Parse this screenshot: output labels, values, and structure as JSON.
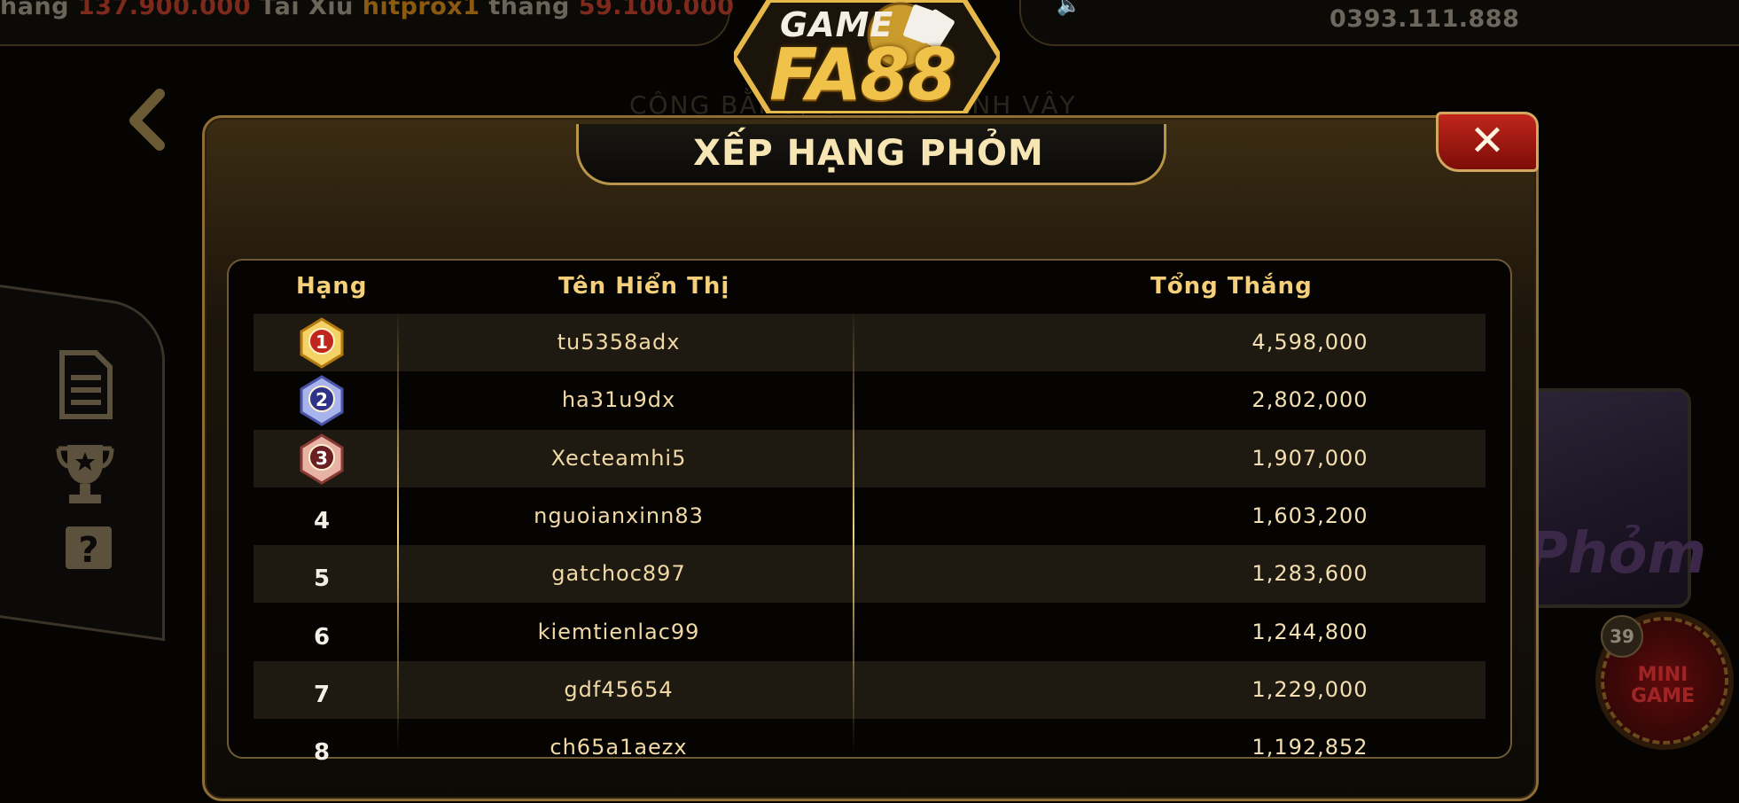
{
  "background": {
    "ticker_left_parts": [
      {
        "text": "hang ",
        "kind": "plain"
      },
      {
        "text": "137.900.000",
        "kind": "amount"
      },
      {
        "text": "   Tài Xỉu ",
        "kind": "plain"
      },
      {
        "text": "hitprox1",
        "kind": "nick"
      },
      {
        "text": " thắng ",
        "kind": "plain"
      },
      {
        "text": "59.100.000",
        "kind": "amount"
      }
    ],
    "hotline": "0393.111.888",
    "slogan": "CÔNG BẰNG, CHỨNG DANH VẬY",
    "tile_text": "Phỏm",
    "mini_game_label": "MINI GAME",
    "mini_game_badge": "39"
  },
  "logo": {
    "game": "GAME",
    "brand": "FA88"
  },
  "modal": {
    "title": "XẾP HẠNG PHỎM",
    "close_label": "✕",
    "columns": {
      "rank": "Hạng",
      "name": "Tên Hiển Thị",
      "total": "Tổng Thắng"
    },
    "rows": [
      {
        "rank": "1",
        "medal": "gold",
        "name": "tu5358adx",
        "total": "4,598,000"
      },
      {
        "rank": "2",
        "medal": "silver",
        "name": "ha31u9dx",
        "total": "2,802,000"
      },
      {
        "rank": "3",
        "medal": "bronze",
        "name": "Xecteamhi5",
        "total": "1,907,000"
      },
      {
        "rank": "4",
        "medal": "",
        "name": "nguoianxinn83",
        "total": "1,603,200"
      },
      {
        "rank": "5",
        "medal": "",
        "name": "gatchoc897",
        "total": "1,283,600"
      },
      {
        "rank": "6",
        "medal": "",
        "name": "kiemtienlac99",
        "total": "1,244,800"
      },
      {
        "rank": "7",
        "medal": "",
        "name": "gdf45654",
        "total": "1,229,000"
      },
      {
        "rank": "8",
        "medal": "",
        "name": "ch65a1aezx",
        "total": "1,192,852"
      }
    ]
  },
  "colors": {
    "gold": "#f5cf7a",
    "close_red": "#c0261c",
    "row_stripe": "#1e1911"
  }
}
